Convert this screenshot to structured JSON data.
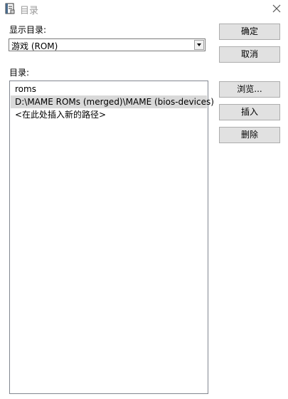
{
  "window": {
    "title": "目录",
    "icon": "catalog-book-icon",
    "close_icon": "close-x-icon"
  },
  "display_dir": {
    "label": "显示目录:",
    "selected": "游戏 (ROM)"
  },
  "dirs": {
    "label": "目录:",
    "items": [
      "roms",
      "D:\\MAME ROMs (merged)\\MAME (bios-devices)",
      "<在此处插入新的路径>"
    ]
  },
  "buttons": {
    "ok": "确定",
    "cancel": "取消",
    "browse": "浏览...",
    "insert": "插入",
    "delete": "删除"
  },
  "colors": {
    "selected_row": "#d9d9d9",
    "title_text": "#9a9a9a"
  }
}
